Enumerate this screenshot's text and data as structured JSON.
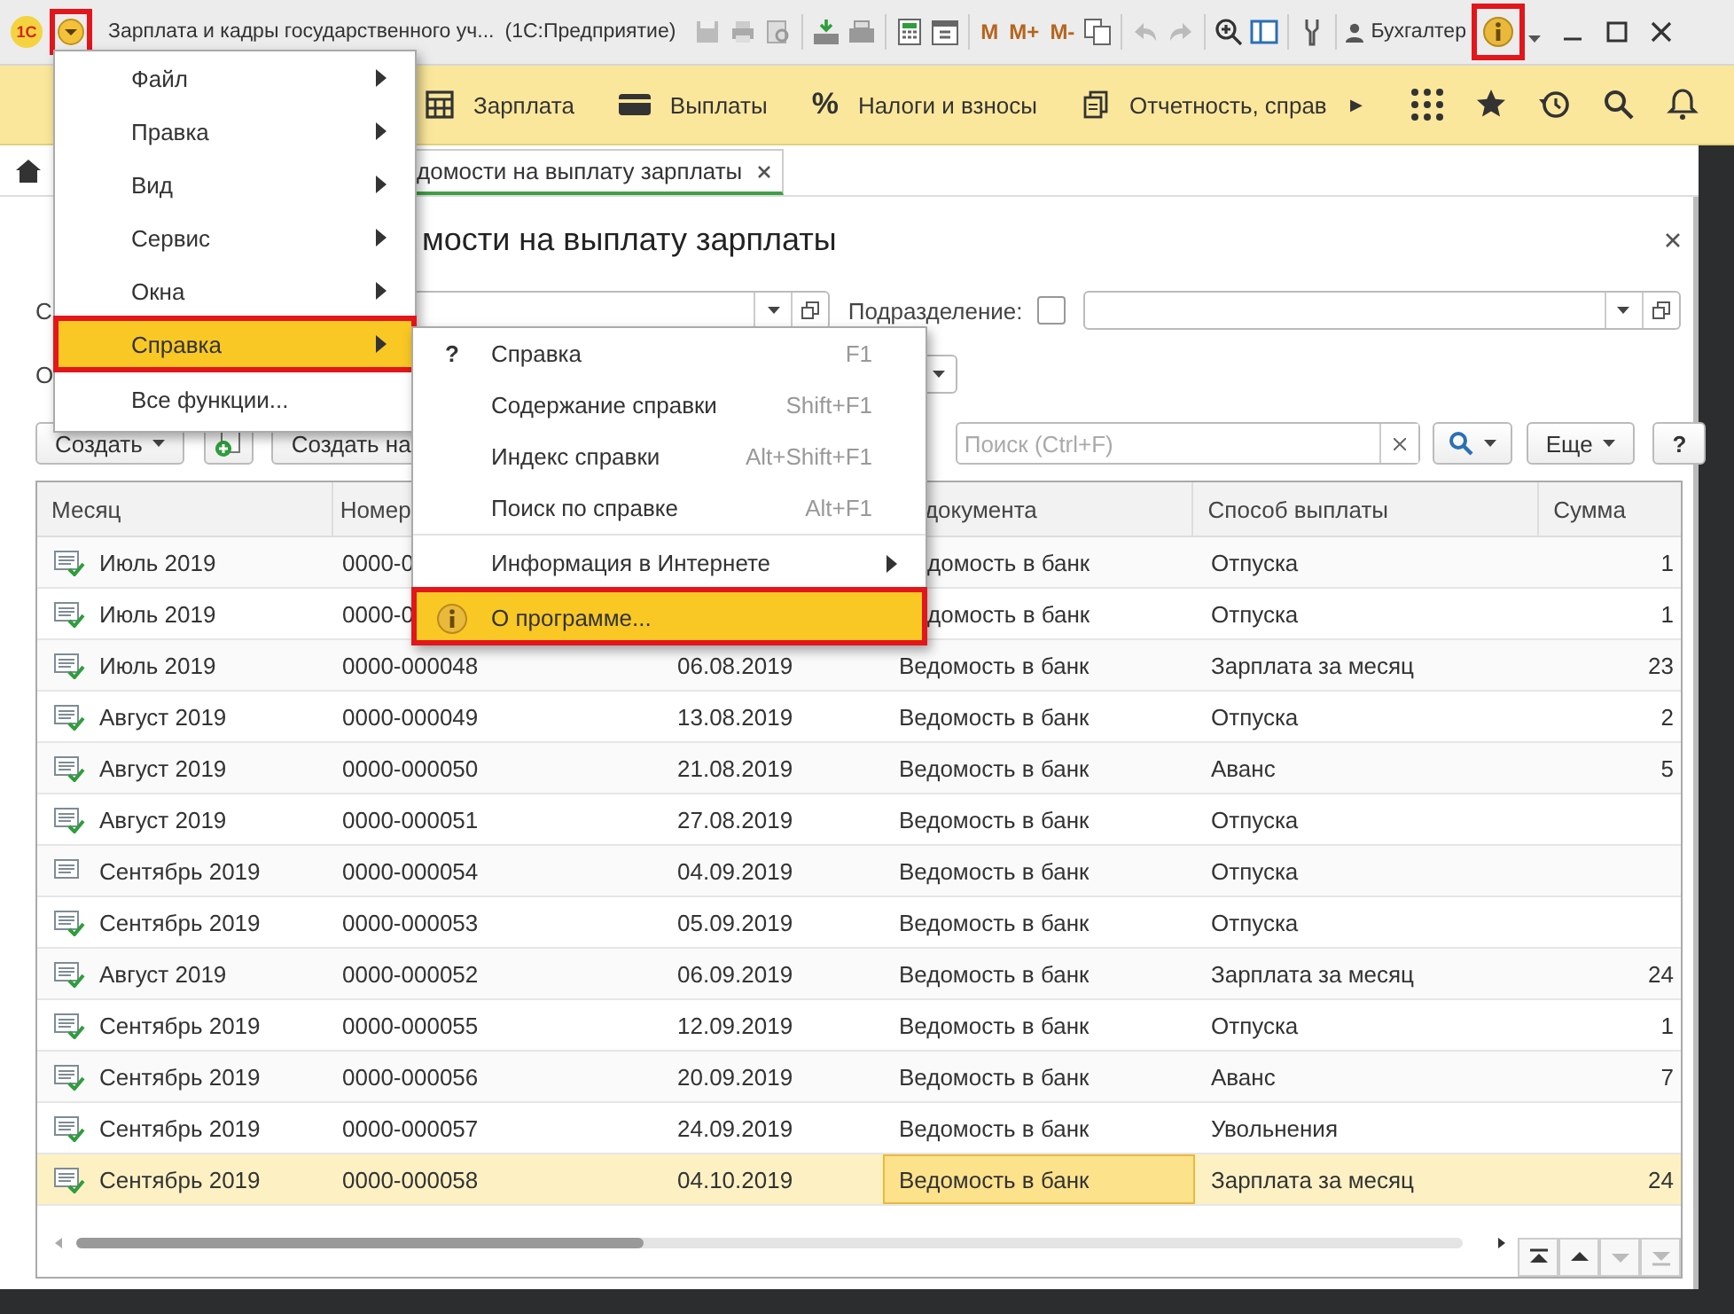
{
  "title_bar": {
    "logo": "1С",
    "menu_button": {
      "highlighted": true
    },
    "title": "Зарплата и кадры государственного уч...",
    "app_name": "(1С:Предприятие)",
    "memory_buttons": [
      "M",
      "M+",
      "M-"
    ],
    "user": "Бухгалтер",
    "info_button": {
      "highlighted": true
    }
  },
  "sections": {
    "items": [
      {
        "kind": "calculator",
        "label": "Зарплата"
      },
      {
        "kind": "card",
        "label": "Выплаты"
      },
      {
        "kind": "percent",
        "symbol": "%",
        "label": "Налоги и взносы"
      },
      {
        "kind": "documents",
        "label": "Отчетность, справ"
      }
    ],
    "more": "▶"
  },
  "tabs": [
    {
      "label": "домости на выплату зарплаты",
      "selected": true
    }
  ],
  "form": {
    "title": "мости на выплату зарплаты",
    "first_filter_label": "С",
    "subdivision_label": "Подразделение:",
    "subdivision_checked": false,
    "second_filter_label": "О",
    "toolbar": {
      "create": "Создать",
      "create_based": "Создать на",
      "search_placeholder": "Поиск (Ctrl+F)",
      "more": "Еще",
      "help": "?"
    }
  },
  "table": {
    "columns": [
      "Месяц",
      "Номер",
      "документа",
      "Способ выплаты",
      "Сумма"
    ],
    "rows": [
      {
        "posted": true,
        "selected": false,
        "doc_type_current": false,
        "month": "Июль 2019",
        "number": "0000-0",
        "doc_type": "домость в банк",
        "payment": "Отпуска",
        "sum": "1"
      },
      {
        "posted": true,
        "selected": false,
        "doc_type_current": false,
        "month": "Июль 2019",
        "number": "0000-0",
        "doc_type": "домость в банк",
        "payment": "Отпуска",
        "sum": "1"
      },
      {
        "posted": true,
        "selected": false,
        "doc_type_current": false,
        "month": "Июль 2019",
        "number": "0000-000048",
        "date": "06.08.2019",
        "doc_type": "Ведомость в банк",
        "payment": "Зарплата за месяц",
        "sum": "23"
      },
      {
        "posted": true,
        "selected": false,
        "doc_type_current": false,
        "month": "Август 2019",
        "number": "0000-000049",
        "date": "13.08.2019",
        "doc_type": "Ведомость в банк",
        "payment": "Отпуска",
        "sum": "2"
      },
      {
        "posted": true,
        "selected": false,
        "doc_type_current": false,
        "month": "Август 2019",
        "number": "0000-000050",
        "date": "21.08.2019",
        "doc_type": "Ведомость в банк",
        "payment": "Аванс",
        "sum": "5"
      },
      {
        "posted": true,
        "selected": false,
        "doc_type_current": false,
        "month": "Август 2019",
        "number": "0000-000051",
        "date": "27.08.2019",
        "doc_type": "Ведомость в банк",
        "payment": "Отпуска"
      },
      {
        "posted": false,
        "selected": false,
        "doc_type_current": false,
        "month": "Сентябрь 2019",
        "number": "0000-000054",
        "date": "04.09.2019",
        "doc_type": "Ведомость в банк",
        "payment": "Отпуска"
      },
      {
        "posted": true,
        "selected": false,
        "doc_type_current": false,
        "month": "Сентябрь 2019",
        "number": "0000-000053",
        "date": "05.09.2019",
        "doc_type": "Ведомость в банк",
        "payment": "Отпуска"
      },
      {
        "posted": true,
        "selected": false,
        "doc_type_current": false,
        "month": "Август 2019",
        "number": "0000-000052",
        "date": "06.09.2019",
        "doc_type": "Ведомость в банк",
        "payment": "Зарплата за месяц",
        "sum": "24"
      },
      {
        "posted": true,
        "selected": false,
        "doc_type_current": false,
        "month": "Сентябрь 2019",
        "number": "0000-000055",
        "date": "12.09.2019",
        "doc_type": "Ведомость в банк",
        "payment": "Отпуска",
        "sum": "1"
      },
      {
        "posted": true,
        "selected": false,
        "doc_type_current": false,
        "month": "Сентябрь 2019",
        "number": "0000-000056",
        "date": "20.09.2019",
        "doc_type": "Ведомость в банк",
        "payment": "Аванс",
        "sum": "7"
      },
      {
        "posted": true,
        "selected": false,
        "doc_type_current": false,
        "month": "Сентябрь 2019",
        "number": "0000-000057",
        "date": "24.09.2019",
        "doc_type": "Ведомость в банк",
        "payment": "Увольнения"
      },
      {
        "posted": true,
        "selected": true,
        "doc_type_current": true,
        "month": "Сентябрь 2019",
        "number": "0000-000058",
        "date": "04.10.2019",
        "doc_type": "Ведомость в банк",
        "payment": "Зарплата за месяц",
        "sum": "24"
      }
    ],
    "nav_buttons": [
      {
        "kind": "first",
        "disabled": false
      },
      {
        "kind": "up",
        "disabled": false
      },
      {
        "kind": "down",
        "disabled": true
      },
      {
        "kind": "last",
        "disabled": true
      }
    ]
  },
  "main_menu": [
    {
      "label": "Файл",
      "submenu": true,
      "selected": false,
      "highlighted": false
    },
    {
      "label": "Правка",
      "submenu": true,
      "selected": false,
      "highlighted": false
    },
    {
      "label": "Вид",
      "submenu": true,
      "selected": false,
      "highlighted": false
    },
    {
      "label": "Сервис",
      "submenu": true,
      "selected": false,
      "highlighted": false
    },
    {
      "label": "Окна",
      "submenu": true,
      "selected": false,
      "highlighted": false
    },
    {
      "label": "Справка",
      "submenu": true,
      "selected": true,
      "highlighted": true
    },
    {
      "label": "Все функции...",
      "submenu": false,
      "selected": false,
      "highlighted": false
    }
  ],
  "help_menu": [
    {
      "kind": "help",
      "icon_text": "?",
      "label": "Справка",
      "shortcut": "F1",
      "submenu": false,
      "separator_before": false,
      "selected": false,
      "highlighted": false
    },
    {
      "kind": "plain",
      "label": "Содержание справки",
      "shortcut": "Shift+F1",
      "submenu": false,
      "separator_before": false,
      "selected": false,
      "highlighted": false
    },
    {
      "kind": "plain",
      "label": "Индекс справки",
      "shortcut": "Alt+Shift+F1",
      "submenu": false,
      "separator_before": false,
      "selected": false,
      "highlighted": false
    },
    {
      "kind": "plain",
      "label": "Поиск по справке",
      "shortcut": "Alt+F1",
      "submenu": false,
      "separator_before": false,
      "selected": false,
      "highlighted": false
    },
    {
      "kind": "plain",
      "label": "Информация в Интернете",
      "submenu": true,
      "separator_before": true,
      "selected": false,
      "highlighted": false
    },
    {
      "kind": "info",
      "label": "О программе...",
      "submenu": false,
      "separator_before": true,
      "selected": true,
      "highlighted": true
    }
  ]
}
